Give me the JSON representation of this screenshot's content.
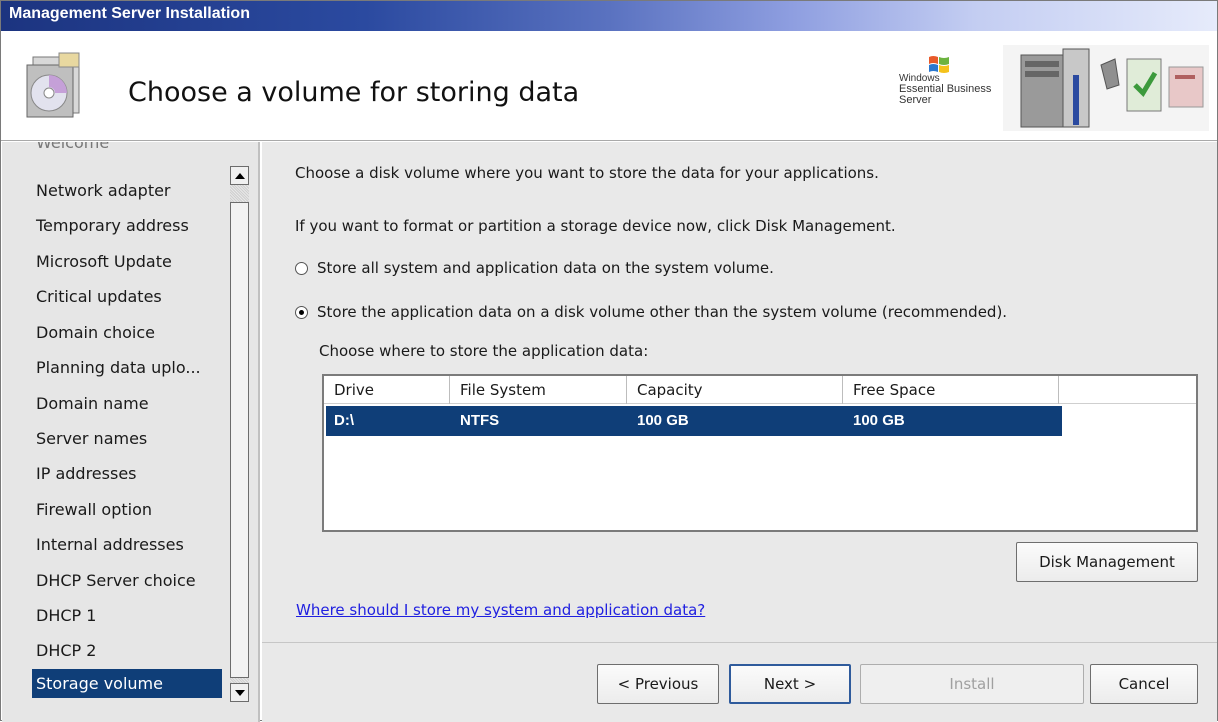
{
  "window": {
    "title": "Management Server Installation"
  },
  "header": {
    "title": "Choose a volume for storing data",
    "brand_line1": "Windows",
    "brand_line2": "Essential Business Server"
  },
  "nav": {
    "items": [
      {
        "label": "Welcome",
        "state": "cut"
      },
      {
        "label": "Network adapter"
      },
      {
        "label": "Temporary address"
      },
      {
        "label": "Microsoft Update"
      },
      {
        "label": "Critical updates"
      },
      {
        "label": "Domain choice"
      },
      {
        "label": "Planning data uplo..."
      },
      {
        "label": "Domain name"
      },
      {
        "label": "Server names"
      },
      {
        "label": "IP addresses"
      },
      {
        "label": "Firewall option"
      },
      {
        "label": "Internal addresses"
      },
      {
        "label": "DHCP Server choice"
      },
      {
        "label": "DHCP 1"
      },
      {
        "label": "DHCP 2"
      },
      {
        "label": "Storage volume",
        "state": "selected"
      }
    ]
  },
  "content": {
    "intro": "Choose a disk volume where you want to store the data for your applications.",
    "format_hint": "If you want to format or partition a storage device now, click Disk Management.",
    "option_system": "Store all system and application data on the system volume.",
    "option_other": "Store the application data on a disk volume other than the system volume (recommended).",
    "choose_where": "Choose where to store the application data:",
    "selected_option": "option_other",
    "table": {
      "columns": [
        "Drive",
        "File System",
        "Capacity",
        "Free Space"
      ],
      "rows": [
        [
          "D:\\",
          "NTFS",
          "100 GB",
          "100 GB"
        ]
      ]
    },
    "disk_management_label": "Disk Management",
    "help_link": "Where should I store my system and application data?"
  },
  "footer": {
    "previous_label": "< Previous",
    "next_label": "Next >",
    "install_label": "Install",
    "cancel_label": "Cancel"
  },
  "colors": {
    "selection": "#0f3e78",
    "link": "#2020e0"
  }
}
